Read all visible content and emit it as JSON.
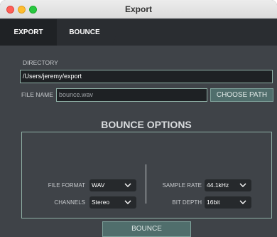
{
  "window": {
    "title": "Export"
  },
  "tabs": {
    "export": "EXPORT",
    "bounce": "BOUNCE"
  },
  "directory": {
    "label": "DIRECTORY",
    "value": "/Users/jeremy/export"
  },
  "file": {
    "label": "FILE NAME",
    "value": "bounce.wav",
    "choose_label": "CHOOSE PATH"
  },
  "options": {
    "title": "BOUNCE OPTIONS",
    "file_format": {
      "label": "FILE FORMAT",
      "value": "WAV"
    },
    "channels": {
      "label": "CHANNELS",
      "value": "Stereo"
    },
    "sample_rate": {
      "label": "SAMPLE RATE",
      "value": "44.1kHz"
    },
    "bit_depth": {
      "label": "BIT DEPTH",
      "value": "16bit"
    }
  },
  "actions": {
    "bounce_label": "BOUNCE"
  },
  "colors": {
    "accent": "#506e6c",
    "border": "#8fb0a6",
    "background": "#3f4348"
  }
}
